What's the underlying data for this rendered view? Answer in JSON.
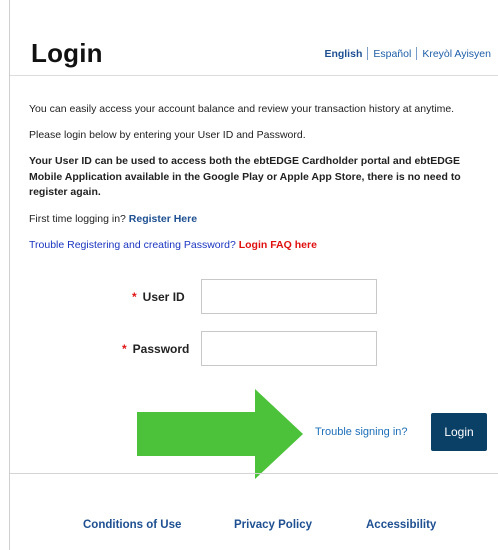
{
  "header": {
    "title": "Login",
    "languages": [
      "English",
      "Español",
      "Kreyòl Ayisyen"
    ],
    "active_language": "English"
  },
  "intro": {
    "line1": "You can easily access your account balance and review your transaction history at anytime.",
    "line2": "Please login below by entering your User ID and Password.",
    "notice": "Your User ID can be used to access both the ebtEDGE Cardholder portal and ebtEDGE Mobile Application available in the Google Play or Apple App Store, there is no need to register again.",
    "first_time_prefix": "First time logging in? ",
    "register_link": "Register Here",
    "trouble_prefix": "Trouble Registering and creating Password? ",
    "faq_link": "Login FAQ here"
  },
  "form": {
    "required_marker": "*",
    "user_id_label": "User ID",
    "user_id_value": "",
    "password_label": "Password",
    "password_value": ""
  },
  "actions": {
    "trouble_signing_in": "Trouble signing in?",
    "login_button": "Login"
  },
  "footer": {
    "links": [
      "Conditions of Use",
      "Privacy Policy",
      "Accessibility"
    ]
  },
  "colors": {
    "arrow": "#4cc23a",
    "login_button": "#0a3f66",
    "link_blue": "#1d4f91",
    "faq_red": "#e00f0f",
    "required_red": "#e01414"
  },
  "icons": {
    "arrow": "right-arrow-icon"
  }
}
